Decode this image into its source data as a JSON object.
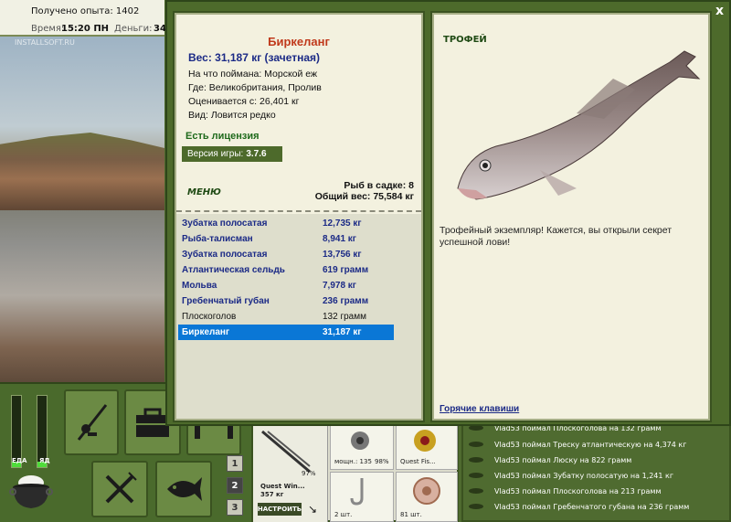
{
  "status": {
    "xp": "Получено опыта: 1402",
    "time_label": "Время:",
    "time_value": "15:20 ПН",
    "money_label": "Деньги:",
    "money_value": "34"
  },
  "watermark": "INSTALLSOFT.RU",
  "modal": {
    "close_label": "x"
  },
  "fish": {
    "name": "Биркеланг",
    "weight": "Вес: 31,187 кг (зачетная)",
    "caught_on": "На что поймана: Морской еж",
    "location": "Где: Великобритания, Пролив",
    "valued_from": "Оценивается с: 26,401 кг",
    "rarity": "Вид: Ловится редко"
  },
  "license": "Есть лицензия",
  "version": {
    "label": "Версия игры:",
    "value": "3.7.6"
  },
  "menu_label": "МЕНЮ",
  "cage": {
    "count": "Рыб в садке: 8",
    "total": "Общий вес: 75,584 кг"
  },
  "catches": [
    {
      "name": "Зубатка полосатая",
      "weight": "12,735 кг",
      "style": "bold"
    },
    {
      "name": "Рыба-талисман",
      "weight": "8,941 кг",
      "style": "bold"
    },
    {
      "name": "Зубатка полосатая",
      "weight": "13,756 кг",
      "style": "bold"
    },
    {
      "name": "Атлантическая сельдь",
      "weight": "619 грамм",
      "style": "bold"
    },
    {
      "name": "Мольва",
      "weight": "7,978 кг",
      "style": "bold"
    },
    {
      "name": "Гребенчатый губан",
      "weight": "236 грамм",
      "style": "bold"
    },
    {
      "name": "Плоскоголов",
      "weight": "132 грамм",
      "style": "plain"
    },
    {
      "name": "Биркеланг",
      "weight": "31,187 кг",
      "style": "selected"
    }
  ],
  "trophy": {
    "label": "ТРОФЕЙ",
    "text": "Трофейный экземпляр! Кажется, вы открыли секрет успешной лови!",
    "hotkeys": "Горячие клавиши"
  },
  "meters": [
    {
      "label": "ЕДА",
      "level": 0.08
    },
    {
      "label": "ЯД",
      "level": 0.08
    }
  ],
  "pages": [
    "1",
    "2",
    "3"
  ],
  "tackle": {
    "rod_name": "Quest Win...",
    "rod_weight": "357 кг",
    "rod_percent": "97%",
    "configure_label": "НАСТРОИТЬ",
    "reel_power": "мощн.: 135",
    "reel_percent": "98%",
    "line_name": "Quest Fis...",
    "hook_count": "2 шт.",
    "bait_count": "81 шт."
  },
  "chat": [
    "Vlad53 поймал Плоскоголова на 132 грамм",
    "Vlad53 поймал Треску атлантическую на 4,374 кг",
    "Vlad53 поймал Люску на 822 грамм",
    "Vlad53 поймал Зубатку полосатую на 1,241 кг",
    "Vlad53 поймал Плоскоголова на 213 грамм",
    "Vlad53 поймал Гребенчатого губана на 236 грамм"
  ],
  "colors": {
    "panel_green": "#4d6a2b",
    "card_bg": "#f3f1df",
    "title_red": "#c0391b",
    "navy": "#1b2a86",
    "selection": "#0a77d6"
  }
}
